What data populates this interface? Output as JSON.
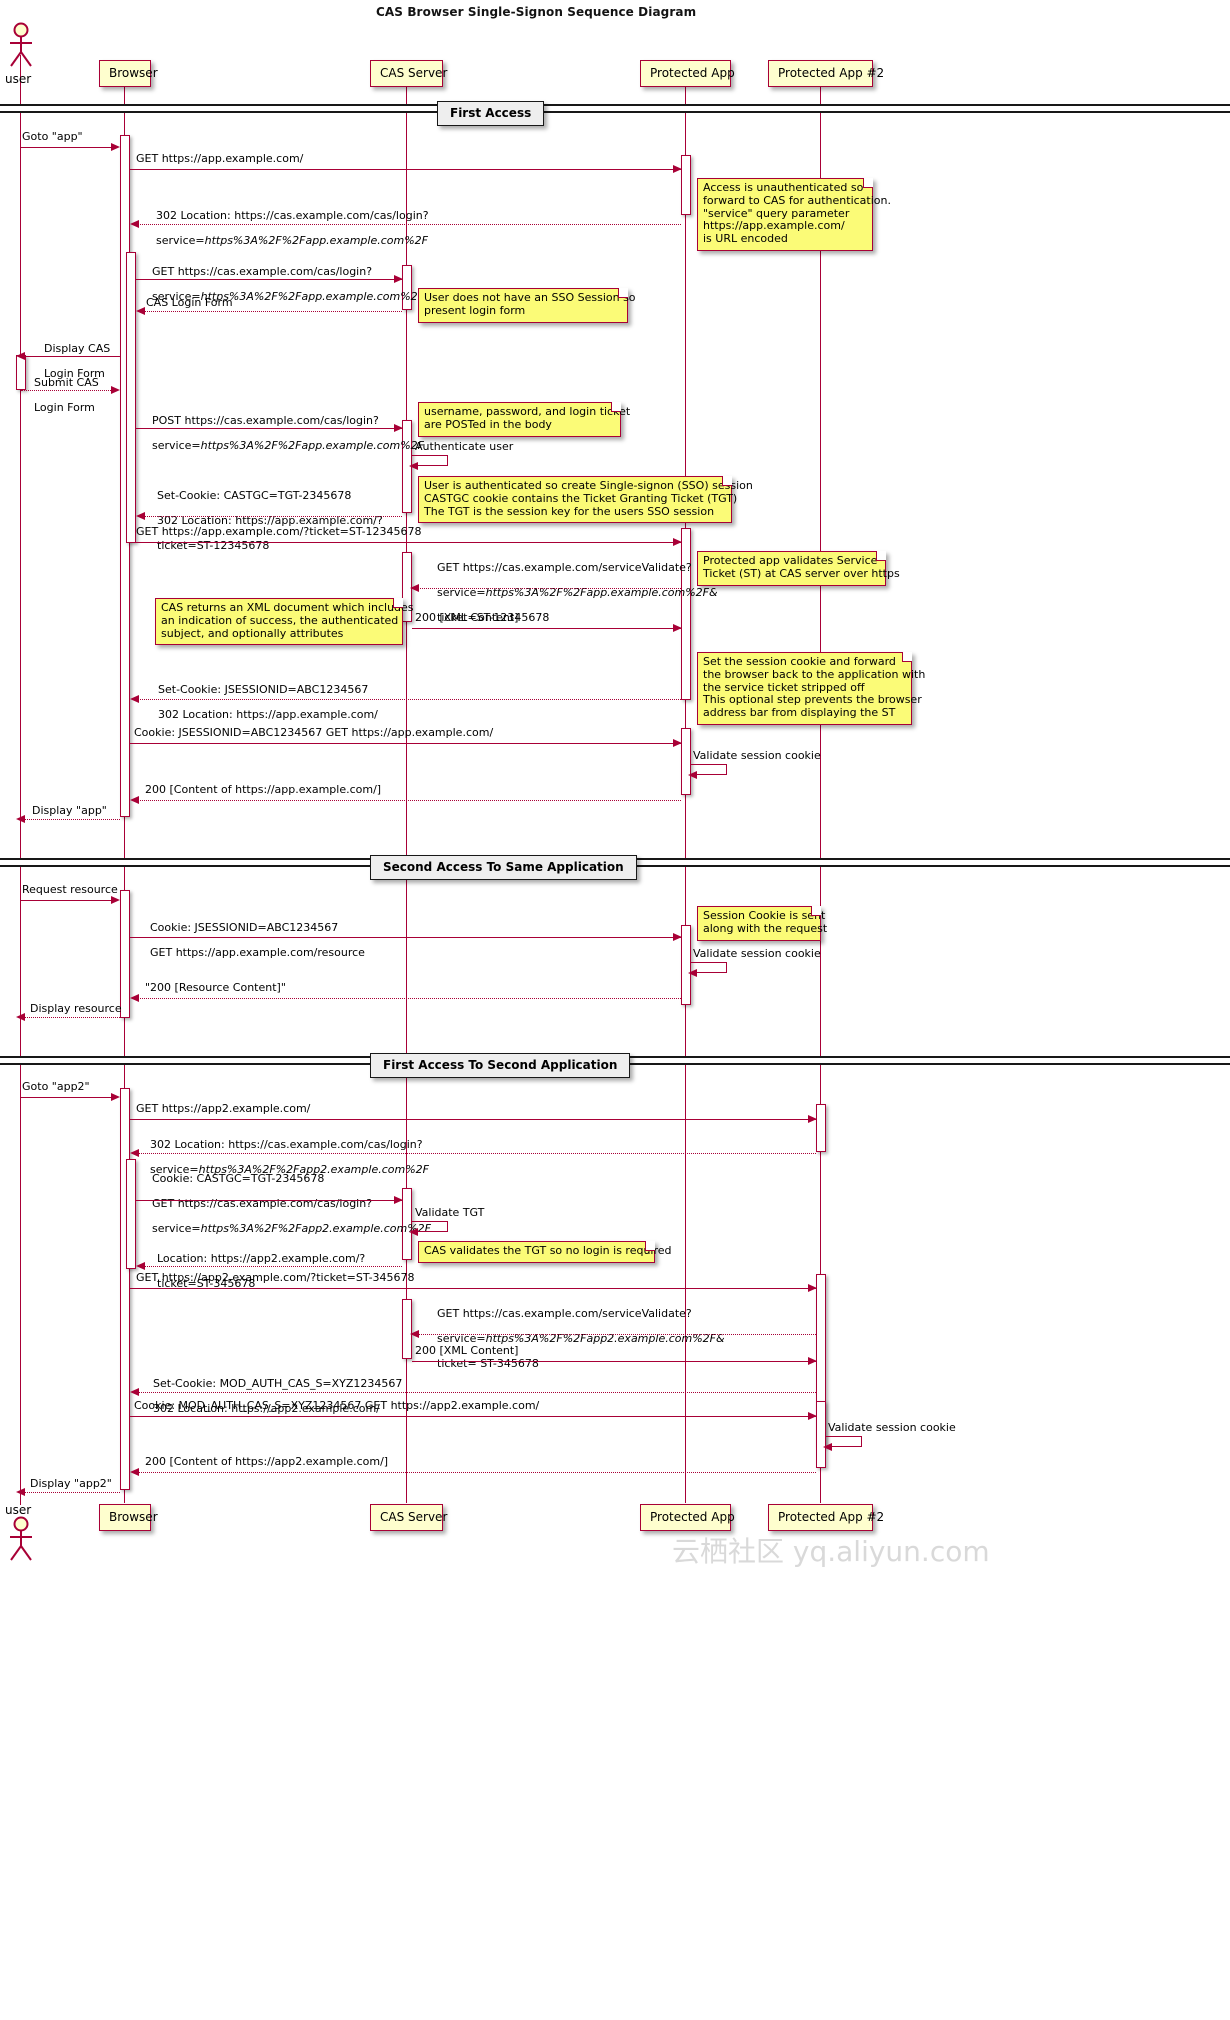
{
  "title": "CAS Browser Single-Signon Sequence Diagram",
  "watermark": "云栖社区 yq.aliyun.com",
  "participants": [
    {
      "name": "user",
      "label": "user",
      "type": "actor"
    },
    {
      "name": "browser",
      "label": "Browser",
      "type": "box"
    },
    {
      "name": "cas-server",
      "label": "CAS Server",
      "type": "box"
    },
    {
      "name": "protected-app",
      "label": "Protected App",
      "type": "box"
    },
    {
      "name": "protected-app-2",
      "label": "Protected App #2",
      "type": "box"
    }
  ],
  "dividers": [
    {
      "name": "first-access",
      "label": "First Access"
    },
    {
      "name": "second-access-same-application",
      "label": "Second Access To Same Application"
    },
    {
      "name": "first-access-second-application",
      "label": "First Access To Second Application"
    }
  ],
  "messages": [
    {
      "id": "m01",
      "text": "Goto \"app\""
    },
    {
      "id": "m02",
      "text": "GET https://app.example.com/"
    },
    {
      "id": "m03",
      "line1": "302 Location: https://cas.example.com/cas/login?",
      "line2": "service=",
      "em2": "https%3A%2F%2Fapp.example.com%2F"
    },
    {
      "id": "m04",
      "line1": "GET https://cas.example.com/cas/login?",
      "line2": "service=",
      "em2": "https%3A%2F%2Fapp.example.com%2F"
    },
    {
      "id": "m05",
      "text": "CAS Login Form"
    },
    {
      "id": "m06",
      "line1": "Display CAS",
      "line2": "Login Form"
    },
    {
      "id": "m07",
      "line1": "Submit CAS",
      "line2": "Login Form"
    },
    {
      "id": "m08",
      "line1": "POST https://cas.example.com/cas/login?",
      "line2": "service=",
      "em2": "https%3A%2F%2Fapp.example.com%2F"
    },
    {
      "id": "m09",
      "text": "Authenticate user"
    },
    {
      "id": "m10",
      "line1": "Set-Cookie: CASTGC=TGT-2345678",
      "line2": "302 Location: https://app.example.com/?",
      "line3": "ticket=ST-12345678"
    },
    {
      "id": "m11",
      "text": "GET https://app.example.com/?ticket=ST-12345678"
    },
    {
      "id": "m12",
      "line1": "GET https://cas.example.com/serviceValidate?",
      "line2": "service=",
      "em2": "https%3A%2F%2Fapp.example.com%2F&",
      "line3": "ticket=ST-12345678"
    },
    {
      "id": "m13",
      "text": "200 [XML Content]"
    },
    {
      "id": "m14",
      "line1": "Set-Cookie: JSESSIONID=ABC1234567",
      "line2": "302 Location: https://app.example.com/"
    },
    {
      "id": "m15",
      "text": "Cookie: JSESSIONID=ABC1234567 GET https://app.example.com/"
    },
    {
      "id": "m16",
      "text": "Validate session cookie"
    },
    {
      "id": "m17",
      "text": "200 [Content of https://app.example.com/]"
    },
    {
      "id": "m18",
      "text": "Display \"app\""
    },
    {
      "id": "m19",
      "text": "Request resource"
    },
    {
      "id": "m20",
      "line1": "Cookie: JSESSIONID=ABC1234567",
      "line2": "GET https://app.example.com/resource"
    },
    {
      "id": "m21",
      "text": "Validate session cookie"
    },
    {
      "id": "m22",
      "text": "\"200 [Resource Content]\""
    },
    {
      "id": "m23",
      "text": "Display resource"
    },
    {
      "id": "m24",
      "text": "Goto \"app2\""
    },
    {
      "id": "m25",
      "text": "GET https://app2.example.com/"
    },
    {
      "id": "m26",
      "line1": "302 Location: https://cas.example.com/cas/login?",
      "line2": "service=",
      "em2": "https%3A%2F%2Fapp2.example.com%2F"
    },
    {
      "id": "m27",
      "line1": "Cookie: CASTGC=TGT-2345678",
      "line2": "GET https://cas.example.com/cas/login?",
      "line3": "service=",
      "em3": "https%3A%2F%2Fapp2.example.com%2F"
    },
    {
      "id": "m28",
      "text": "Validate TGT"
    },
    {
      "id": "m29",
      "line1": "Location: https://app2.example.com/?",
      "line2": "ticket=ST-345678"
    },
    {
      "id": "m30",
      "text": "GET https://app2.example.com/?ticket=ST-345678"
    },
    {
      "id": "m31",
      "line1": "GET https://cas.example.com/serviceValidate?",
      "line2": "service=",
      "em2": "https%3A%2F%2Fapp2.example.com%2F&",
      "line3": "ticket= ST-345678"
    },
    {
      "id": "m32",
      "text": "200 [XML Content]"
    },
    {
      "id": "m33",
      "line1": "Set-Cookie: MOD_AUTH_CAS_S=XYZ1234567",
      "line2": "302 Location: https://app2.example.com/"
    },
    {
      "id": "m34",
      "text": "Cookie: MOD_AUTH_CAS_S=XYZ1234567 GET https://app2.example.com/"
    },
    {
      "id": "m35",
      "text": "Validate session cookie"
    },
    {
      "id": "m36",
      "text": "200 [Content of https://app2.example.com/]"
    },
    {
      "id": "m37",
      "text": "Display \"app2\""
    }
  ],
  "notes": [
    {
      "id": "n1",
      "text": "Access is unauthenticated so\nforward to CAS for authentication.\n\"service\" query parameter\nhttps://app.example.com/\nis URL encoded"
    },
    {
      "id": "n2",
      "text": "User does not have an SSO Session so\npresent login form"
    },
    {
      "id": "n3",
      "text": "username, password, and login ticket\nare POSTed in the body"
    },
    {
      "id": "n4",
      "text": "User is authenticated so create Single-signon (SSO) session\nCASTGC cookie contains the Ticket Granting Ticket (TGT)\nThe TGT is the session key for the users SSO session"
    },
    {
      "id": "n5",
      "text": "Protected app validates Service\nTicket (ST) at CAS server over https"
    },
    {
      "id": "n6",
      "text": "CAS returns an XML document which includes\nan indication of success, the authenticated\nsubject, and optionally attributes"
    },
    {
      "id": "n7",
      "text": "Set the session cookie and forward\nthe browser back to the application with\nthe service ticket stripped off\nThis optional step prevents the browser\naddress bar from displaying the ST"
    },
    {
      "id": "n8",
      "text": "Session Cookie is sent\nalong with the request"
    },
    {
      "id": "n9",
      "text": "CAS validates the TGT so no login is required"
    }
  ],
  "colors": {
    "accent": "#A80036",
    "note_fill": "#FBFB77",
    "participant_fill": "#FEFECE",
    "divider_fill": "#EEEEEE"
  }
}
